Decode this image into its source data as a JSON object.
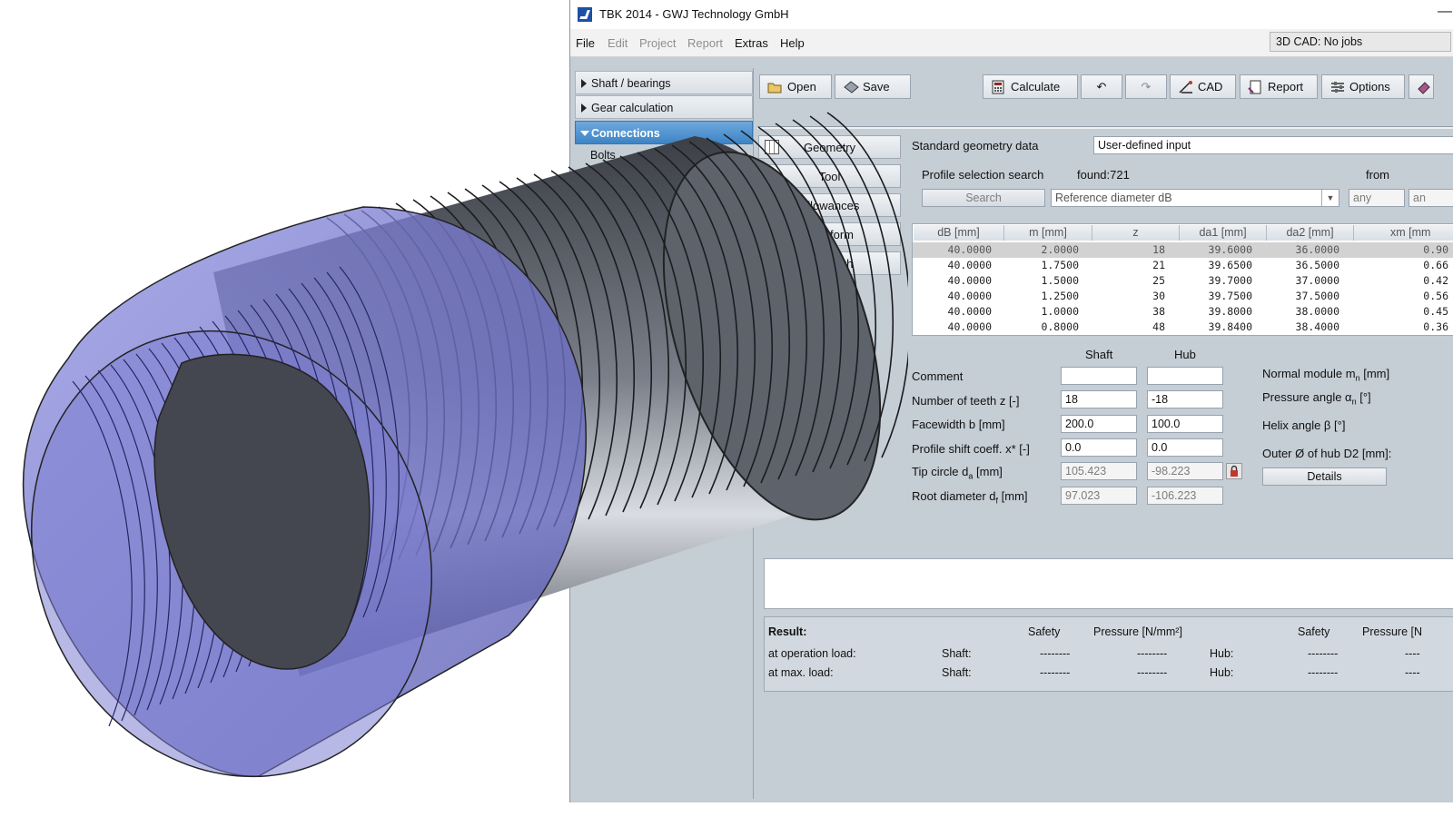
{
  "window": {
    "title": "TBK 2014 - GWJ Technology GmbH",
    "minimize_glyph": "—"
  },
  "menu": {
    "file": "File",
    "edit": "Edit",
    "project": "Project",
    "report": "Report",
    "extras": "Extras",
    "help": "Help",
    "cad_status": "3D CAD: No jobs"
  },
  "sidebar": {
    "shaft_bearings": "Shaft / bearings",
    "gear_calculation": "Gear calculation",
    "connections": "Connections",
    "bolts": "Bolts"
  },
  "toolbar": {
    "open": "Open",
    "save": "Save",
    "calculate": "Calculate",
    "undo": "↶",
    "redo": "↷",
    "cad": "CAD",
    "report": "Report",
    "options": "Options"
  },
  "tabs": {
    "geometry": "Geometry",
    "tool": "Tool",
    "allowances": "Allowances",
    "form": "form",
    "length": "ngth"
  },
  "geometry": {
    "std_label": "Standard geometry data",
    "std_value": "User-defined input",
    "search_label": "Profile selection search",
    "found": "found:721",
    "from": "from",
    "search_button": "Search",
    "search_by": "Reference diameter dB",
    "from_value": "any",
    "to_value": "an"
  },
  "profile_table": {
    "headers": [
      "dB [mm]",
      "m [mm]",
      "z",
      "da1 [mm]",
      "da2 [mm]",
      "xm [mm"
    ],
    "rows": [
      [
        "40.0000",
        "2.0000",
        "18",
        "39.6000",
        "36.0000",
        "0.90"
      ],
      [
        "40.0000",
        "1.7500",
        "21",
        "39.6500",
        "36.5000",
        "0.66"
      ],
      [
        "40.0000",
        "1.5000",
        "25",
        "39.7000",
        "37.0000",
        "0.42"
      ],
      [
        "40.0000",
        "1.2500",
        "30",
        "39.7500",
        "37.5000",
        "0.56"
      ],
      [
        "40.0000",
        "1.0000",
        "38",
        "39.8000",
        "38.0000",
        "0.45"
      ],
      [
        "40.0000",
        "0.8000",
        "48",
        "39.8400",
        "38.4000",
        "0.36"
      ]
    ]
  },
  "params": {
    "col_shaft": "Shaft",
    "col_hub": "Hub",
    "comment": {
      "label": "Comment",
      "shaft": "",
      "hub": ""
    },
    "teeth": {
      "label": "Number of teeth z [-]",
      "shaft": "18",
      "hub": "-18"
    },
    "facewidth": {
      "label": "Facewidth b [mm]",
      "shaft": "200.0",
      "hub": "100.0"
    },
    "profile_shift": {
      "label": "Profile shift coeff. x* [-]",
      "shaft": "0.0",
      "hub": "0.0"
    },
    "tip_circle": {
      "label": "Tip circle d",
      "sub": "a",
      "unit": " [mm]",
      "shaft": "105.423",
      "hub": "-98.223"
    },
    "root_diameter": {
      "label": "Root diameter d",
      "sub": "f",
      "unit": " [mm]",
      "shaft": "97.023",
      "hub": "-106.223"
    }
  },
  "right_params": {
    "normal_module": {
      "label": "Normal module m",
      "sub": "n",
      "unit": " [mm]"
    },
    "pressure_angle": {
      "label": "Pressure angle α",
      "sub": "n",
      "unit": " [°]"
    },
    "helix_angle": "Helix angle β [°]",
    "outer_hub": "Outer Ø of hub D2 [mm]:",
    "details_button": "Details"
  },
  "result": {
    "title": "Result:",
    "safety": "Safety",
    "pressure": "Pressure [N/mm²]",
    "safety2": "Safety",
    "pressure2": "Pressure [N",
    "op_load": "at operation load:",
    "max_load": "at max. load:",
    "shaft": "Shaft:",
    "hub": "Hub:",
    "dash": "--------",
    "dash_short": "----"
  },
  "colors": {
    "accent": "#3d84c6",
    "hub_blue": "#7373c8",
    "shaft_gray": "#555a63"
  },
  "icons": [
    "open-folder-icon",
    "save-disk-icon",
    "calculator-icon",
    "undo-icon",
    "redo-icon",
    "cad-icon",
    "report-icon",
    "options-icon",
    "lock-icon",
    "geometry-grid-icon"
  ]
}
